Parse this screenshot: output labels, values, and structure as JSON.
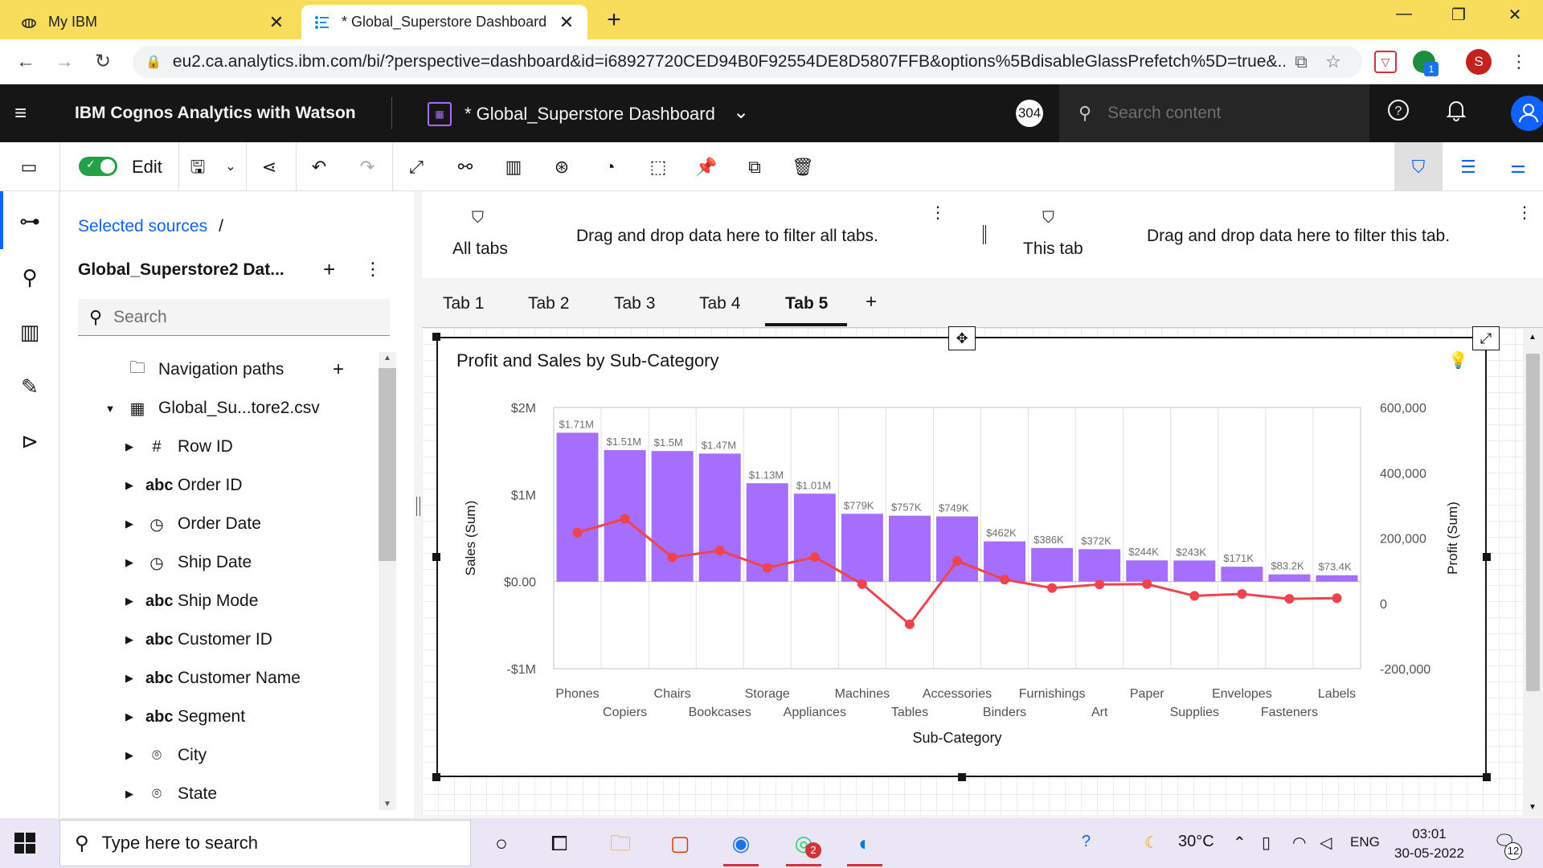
{
  "browser": {
    "tabs": [
      {
        "title": "My IBM",
        "active": false
      },
      {
        "title": "* Global_Superstore Dashboard",
        "active": true
      }
    ],
    "url": "eu2.ca.analytics.ibm.com/bi/?perspective=dashboard&id=i68927720CED94B0F92554DE8D5807FFB&options%5BdisableGlassPrefetch%5D=true&...",
    "profile_initial": "S",
    "extension_badge": "1"
  },
  "header": {
    "brand": "IBM Cognos Analytics with Watson",
    "dashboard_title": "* Global_Superstore Dashboard",
    "notification_count": "304",
    "search_placeholder": "Search content"
  },
  "toolbar": {
    "edit_label": "Edit",
    "edit_on": true
  },
  "sources": {
    "breadcrumb": "Selected sources",
    "breadcrumb_sep": "/",
    "source_name": "Global_Superstore2 Dat...",
    "search_placeholder": "Search",
    "items": [
      {
        "label": "Navigation paths",
        "icon": "folder-icon",
        "level": 0,
        "expandable": false
      },
      {
        "label": "Global_Su...tore2.csv",
        "icon": "table-icon",
        "level": 0,
        "expandable": true
      },
      {
        "label": "Row ID",
        "icon": "#",
        "level": 1,
        "expandable": true
      },
      {
        "label": "Order ID",
        "icon": "abc",
        "level": 1,
        "expandable": true
      },
      {
        "label": "Order Date",
        "icon": "clock-icon",
        "level": 1,
        "expandable": true
      },
      {
        "label": "Ship Date",
        "icon": "clock-icon",
        "level": 1,
        "expandable": true
      },
      {
        "label": "Ship Mode",
        "icon": "abc",
        "level": 1,
        "expandable": true
      },
      {
        "label": "Customer ID",
        "icon": "abc",
        "level": 1,
        "expandable": true
      },
      {
        "label": "Customer Name",
        "icon": "abc",
        "level": 1,
        "expandable": true
      },
      {
        "label": "Segment",
        "icon": "abc",
        "level": 1,
        "expandable": true
      },
      {
        "label": "City",
        "icon": "location-icon",
        "level": 1,
        "expandable": true
      },
      {
        "label": "State",
        "icon": "location-icon",
        "level": 1,
        "expandable": true
      }
    ]
  },
  "filters": {
    "all_tabs_label": "All tabs",
    "all_tabs_hint": "Drag and drop data here to filter all tabs.",
    "this_tab_label": "This tab",
    "this_tab_hint": "Drag and drop data here to filter this tab."
  },
  "dashboard_tabs": [
    "Tab 1",
    "Tab 2",
    "Tab 3",
    "Tab 4",
    "Tab 5"
  ],
  "active_tab": "Tab 5",
  "widget": {
    "title": "Profit and Sales by Sub-Category"
  },
  "chart_data": {
    "type": "bar",
    "title": "Profit and Sales by Sub-Category",
    "xlabel": "Sub-Category",
    "ylabel": "Sales (Sum)",
    "y2label": "Profit (Sum)",
    "ylim": [
      -1000000,
      2000000
    ],
    "y2lim": [
      -200000,
      600000
    ],
    "yticks": [
      "$2M",
      "$1M",
      "$0.00",
      "-$1M"
    ],
    "y2ticks": [
      "600,000",
      "400,000",
      "200,000",
      "0",
      "-200,000"
    ],
    "categories": [
      "Phones",
      "Copiers",
      "Chairs",
      "Bookcases",
      "Storage",
      "Appliances",
      "Machines",
      "Tables",
      "Accessories",
      "Binders",
      "Furnishings",
      "Art",
      "Paper",
      "Supplies",
      "Envelopes",
      "Fasteners",
      "Labels"
    ],
    "series": [
      {
        "name": "Sales (Sum)",
        "type": "bar",
        "color": "#a56eff",
        "values": [
          1710000,
          1510000,
          1500000,
          1470000,
          1130000,
          1010000,
          779000,
          757000,
          749000,
          462000,
          386000,
          372000,
          244000,
          243000,
          171000,
          83200,
          73400
        ],
        "labels": [
          "$1.71M",
          "$1.51M",
          "$1.5M",
          "$1.47M",
          "$1.13M",
          "$1.01M",
          "$779K",
          "$757K",
          "$749K",
          "$462K",
          "$386K",
          "$372K",
          "$244K",
          "$243K",
          "$171K",
          "$83.2K",
          "$73.4K"
        ]
      },
      {
        "name": "Profit (Sum)",
        "type": "line",
        "color": "#f0434e",
        "values": [
          217000,
          259000,
          141000,
          162000,
          109000,
          142000,
          59000,
          -64000,
          130000,
          73000,
          47000,
          58000,
          59000,
          23000,
          29000,
          14000,
          16000
        ]
      }
    ],
    "grid": true
  },
  "taskbar": {
    "search_placeholder": "Type here to search",
    "temperature": "30°C",
    "language": "ENG",
    "time": "03:01",
    "date": "30-05-2022",
    "notifications": "12",
    "whatsapp_badge": "2"
  }
}
